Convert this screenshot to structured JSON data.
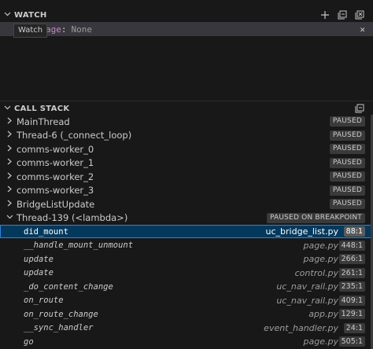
{
  "watch": {
    "title": "WATCH",
    "expression": "age",
    "separator": ":",
    "value": "None",
    "tooltip": "Watch",
    "add_icon": "plus-icon",
    "collapse_icon": "collapse-all-icon",
    "remove_all_icon": "close-all-icon",
    "remove_icon": "close-icon"
  },
  "callstack": {
    "title": "CALL STACK",
    "collapse_icon": "collapse-all-icon",
    "threads": [
      {
        "name": "MainThread",
        "status": "PAUSED",
        "expanded": false
      },
      {
        "name": "Thread-6 (_connect_loop)",
        "status": "PAUSED",
        "expanded": false
      },
      {
        "name": "comms-worker_0",
        "status": "PAUSED",
        "expanded": false
      },
      {
        "name": "comms-worker_1",
        "status": "PAUSED",
        "expanded": false
      },
      {
        "name": "comms-worker_2",
        "status": "PAUSED",
        "expanded": false
      },
      {
        "name": "comms-worker_3",
        "status": "PAUSED",
        "expanded": false
      },
      {
        "name": "BridgeListUpdate",
        "status": "PAUSED",
        "expanded": false
      },
      {
        "name": "Thread-139 (<lambda>)",
        "status": "PAUSED ON BREAKPOINT",
        "expanded": true
      }
    ],
    "frames": [
      {
        "name": "did_mount",
        "file": "uc_bridge_list.py",
        "line": "88:1",
        "selected": true
      },
      {
        "name": "__handle_mount_unmount",
        "file": "page.py",
        "line": "448:1",
        "selected": false
      },
      {
        "name": "update",
        "file": "page.py",
        "line": "266:1",
        "selected": false
      },
      {
        "name": "update",
        "file": "control.py",
        "line": "261:1",
        "selected": false
      },
      {
        "name": "_do_content_change",
        "file": "uc_nav_rail.py",
        "line": "235:1",
        "selected": false
      },
      {
        "name": "on_route",
        "file": "uc_nav_rail.py",
        "line": "409:1",
        "selected": false
      },
      {
        "name": "on_route_change",
        "file": "app.py",
        "line": "129:1",
        "selected": false
      },
      {
        "name": "__sync_handler",
        "file": "event_handler.py",
        "line": "24:1",
        "selected": false
      },
      {
        "name": "go",
        "file": "page.py",
        "line": "505:1",
        "selected": false
      }
    ]
  }
}
